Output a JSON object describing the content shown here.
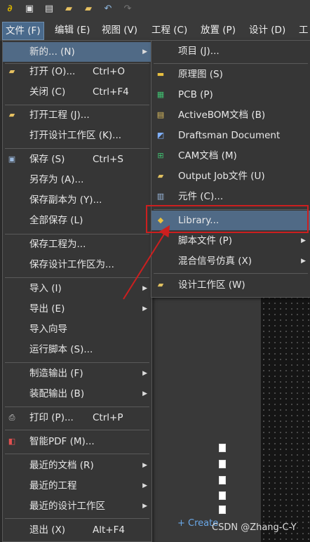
{
  "menubar": {
    "file": "文件 (F)",
    "edit": "编辑 (E)",
    "view": "视图 (V)",
    "project": "工程 (C)",
    "place": "放置 (P)",
    "design": "设计 (D)",
    "tools": "工"
  },
  "file_menu": {
    "new": "新的... (N)",
    "open": "打开 (O)...",
    "open_sc": "Ctrl+O",
    "close": "关闭 (C)",
    "close_sc": "Ctrl+F4",
    "open_project": "打开工程 (J)...",
    "open_workspace": "打开设计工作区 (K)...",
    "save": "保存 (S)",
    "save_sc": "Ctrl+S",
    "save_as": "另存为 (A)...",
    "save_copy": "保存副本为 (Y)...",
    "save_all": "全部保存 (L)",
    "save_project_as": "保存工程为...",
    "save_workspace_as": "保存设计工作区为...",
    "import": "导入 (I)",
    "export": "导出 (E)",
    "import_wizard": "导入向导",
    "run_script": "运行脚本 (S)...",
    "fab_outputs": "制造输出 (F)",
    "assembly_outputs": "装配输出 (B)",
    "print": "打印 (P)...",
    "print_sc": "Ctrl+P",
    "smart_pdf": "智能PDF (M)...",
    "recent_docs": "最近的文档 (R)",
    "recent_projects": "最近的工程",
    "recent_workspaces": "最近的设计工作区",
    "exit": "退出 (X)",
    "exit_sc": "Alt+F4"
  },
  "new_menu": {
    "project": "项目 (J)...",
    "schematic": "原理图 (S)",
    "pcb": "PCB (P)",
    "activebom": "ActiveBOM文档 (B)",
    "draftsman": "Draftsman Document",
    "cam": "CAM文档 (M)",
    "output_job": "Output Job文件 (U)",
    "component": "元件 (C)...",
    "library": "Library...",
    "script_files": "脚本文件 (P)",
    "mixed_sim": "混合信号仿真 (X)",
    "design_workspace": "设计工作区 (W)"
  },
  "panel": {
    "create": "+ Create"
  },
  "watermark": "CSDN @Zhang-C-Y",
  "colors": {
    "highlight": "#506a86",
    "annotation": "#cc1f1f",
    "link": "#6aa8e8"
  }
}
